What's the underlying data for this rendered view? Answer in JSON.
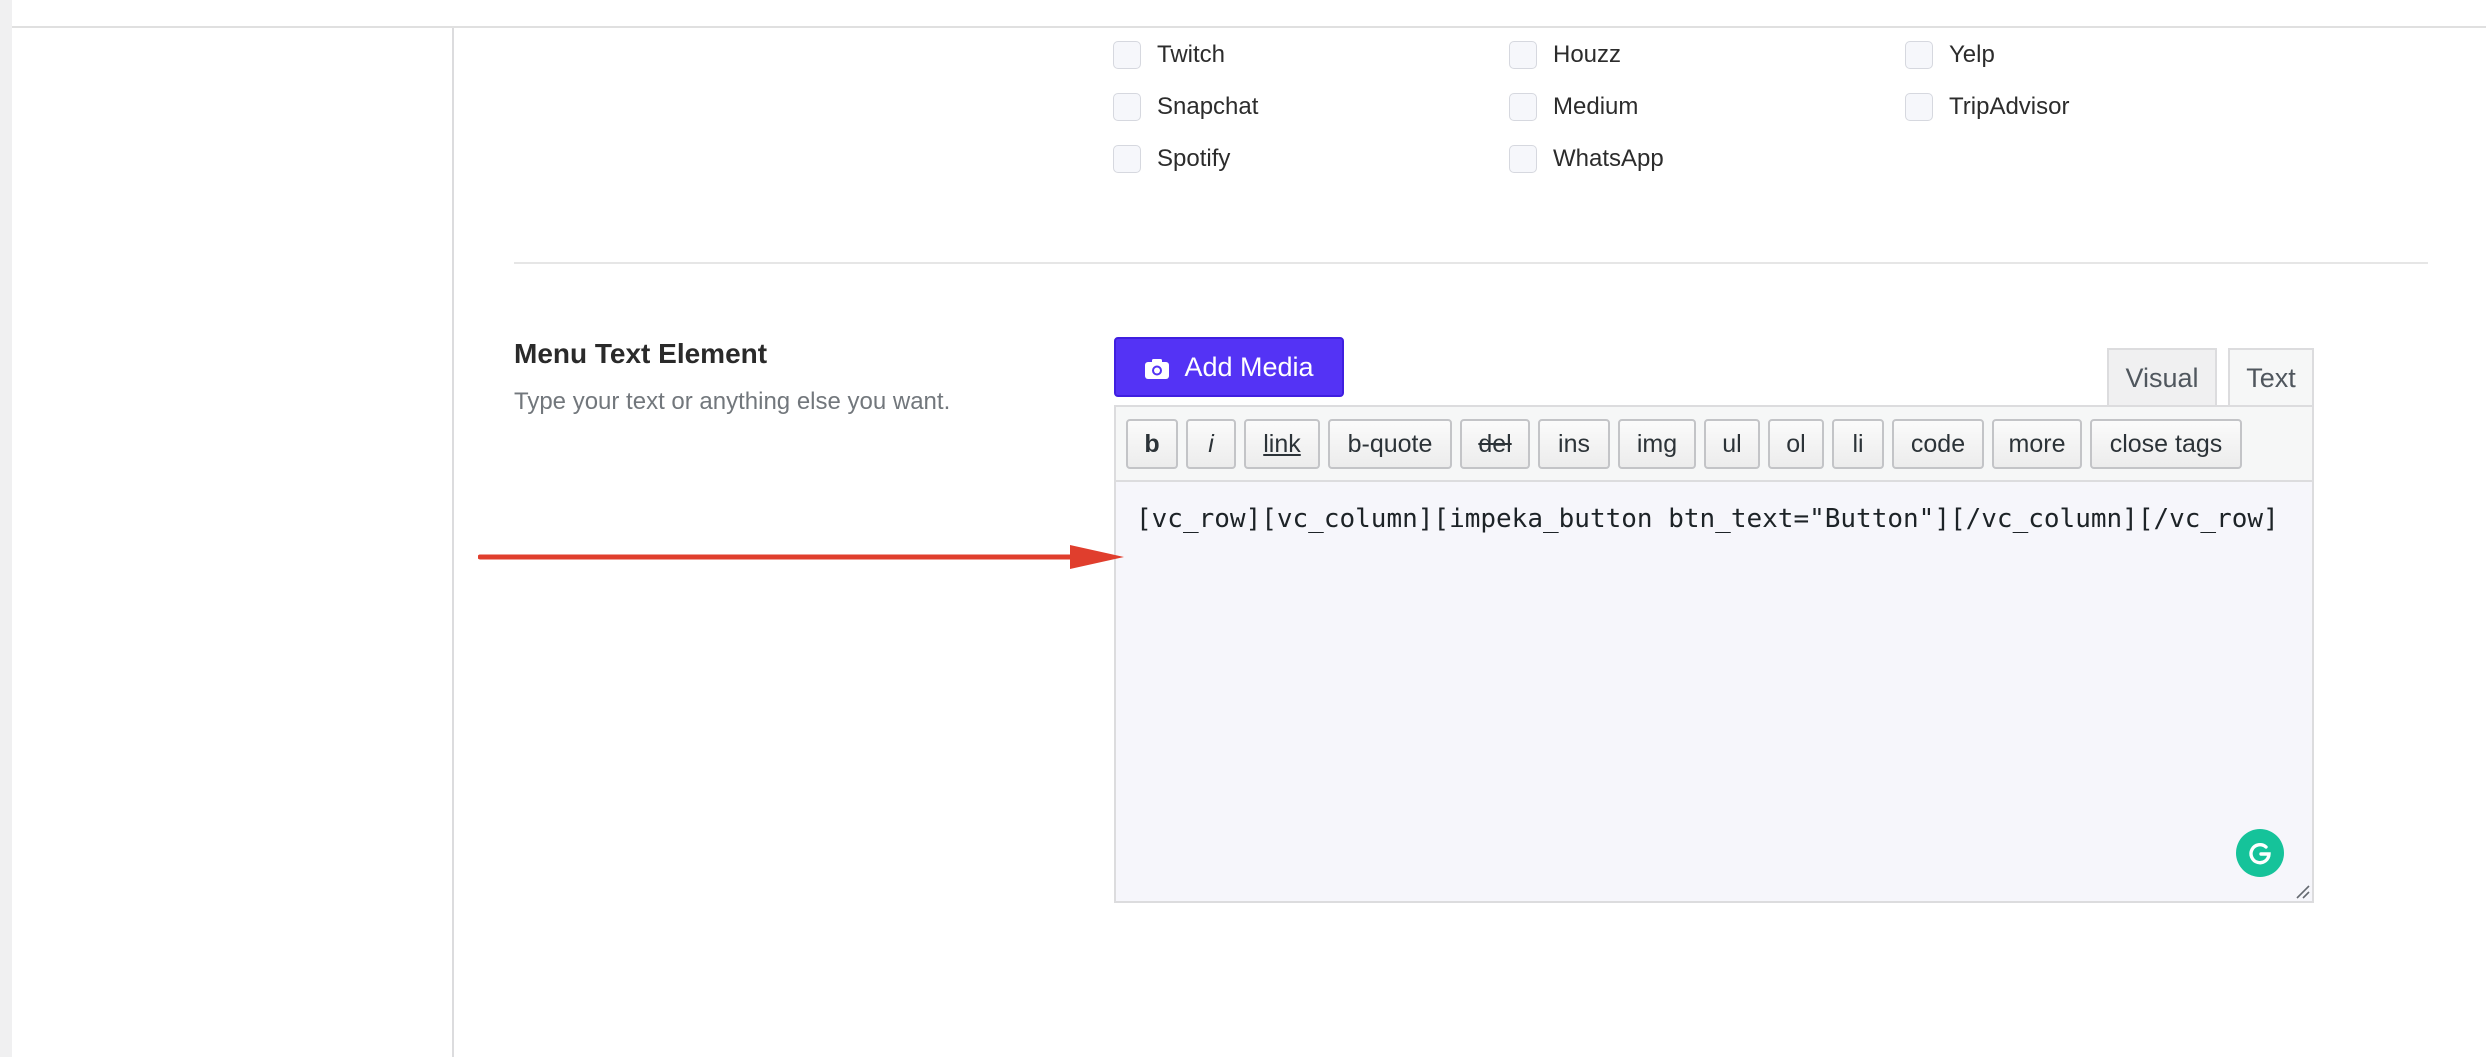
{
  "social": {
    "col1": [
      "Twitch",
      "Snapchat",
      "Spotify"
    ],
    "col2": [
      "Houzz",
      "Medium",
      "WhatsApp"
    ],
    "col3": [
      "Yelp",
      "TripAdvisor"
    ]
  },
  "section": {
    "title": "Menu Text Element",
    "description": "Type your text or anything else you want."
  },
  "editor": {
    "add_media_label": "Add Media",
    "tabs": {
      "visual": "Visual",
      "text": "Text"
    },
    "toolbar": [
      "b",
      "i",
      "link",
      "b-quote",
      "del",
      "ins",
      "img",
      "ul",
      "ol",
      "li",
      "code",
      "more",
      "close tags"
    ],
    "content": "[vc_row][vc_column][impeka_button btn_text=\"Button\"][/vc_column][/vc_row]"
  },
  "colors": {
    "accent": "#5433f5",
    "arrow": "#e03e2d",
    "grammarly": "#15c39a"
  },
  "icons": {
    "add_media": "camera-icon",
    "grammarly": "grammarly-icon"
  }
}
